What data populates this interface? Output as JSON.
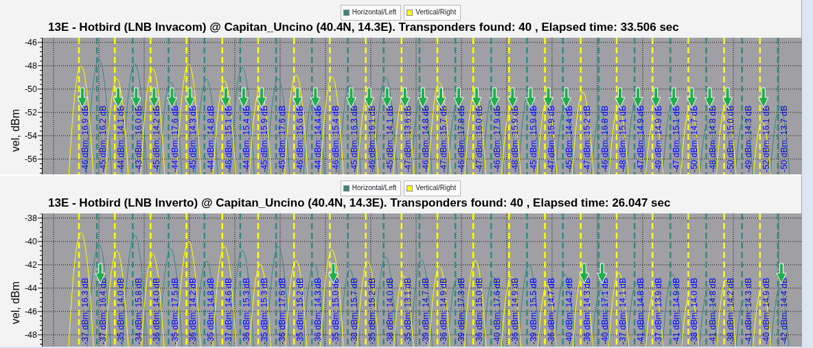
{
  "panels": [
    {
      "legend": [
        {
          "label": "Horizontal/Left",
          "color": "#2e8b80"
        },
        {
          "label": "Vertical/Right",
          "color": "#ffff00"
        }
      ],
      "title": "13E - Hotbird (LNB Invacom) @ Capitan_Uncino (40.4N, 14.3E). Transponders found: 40 , Elapsed time: 33.506 sec",
      "y_axis": {
        "label": "vel, dBm",
        "ticks": [
          "-46",
          "-48",
          "-50",
          "-52",
          "-54",
          "-56"
        ]
      },
      "transponders": [
        {
          "label": "-46 dBm; 16.9 dB",
          "kind": "vertical",
          "arrow": true
        },
        {
          "label": "-45 dBm; 16.2 dB",
          "kind": "horizontal",
          "arrow": false
        },
        {
          "label": "-44 dBm; 14.1 dB",
          "kind": "vertical",
          "arrow": true
        },
        {
          "label": "-43 dBm; 16.0 dB",
          "kind": "horizontal",
          "arrow": true
        },
        {
          "label": "-45 dBm; 14.2 dB",
          "kind": "vertical",
          "arrow": true
        },
        {
          "label": "-44 dBm; 17.6 dB",
          "kind": "horizontal",
          "arrow": true
        },
        {
          "label": "-45 dBm; 14.3 dB",
          "kind": "vertical",
          "arrow": true
        },
        {
          "label": "-44 dBm; 14.8 dB",
          "kind": "horizontal",
          "arrow": false
        },
        {
          "label": "-46 dBm; 15.1 dB",
          "kind": "vertical",
          "arrow": true
        },
        {
          "label": "-44 dBm; 15.4 dB",
          "kind": "horizontal",
          "arrow": true
        },
        {
          "label": "-45 dBm; 15.9 dB",
          "kind": "vertical",
          "arrow": true
        },
        {
          "label": "-45 dBm; 17.6 dB",
          "kind": "horizontal",
          "arrow": false
        },
        {
          "label": "-46 dBm; 15.6 dB",
          "kind": "vertical",
          "arrow": true
        },
        {
          "label": "-44 dBm; 14.4 dB",
          "kind": "horizontal",
          "arrow": true
        },
        {
          "label": "-46 dBm; 15.4 dB",
          "kind": "vertical",
          "arrow": false
        },
        {
          "label": "-45 dBm; 16.3 dB",
          "kind": "horizontal",
          "arrow": true
        },
        {
          "label": "-46 dBm; 16.1 dB",
          "kind": "vertical",
          "arrow": true
        },
        {
          "label": "-45 dBm; 14.1 dB",
          "kind": "horizontal",
          "arrow": true
        },
        {
          "label": "-47 dBm; 13.6 dB",
          "kind": "vertical",
          "arrow": true
        },
        {
          "label": "-46 dBm; 14.8 dB",
          "kind": "horizontal",
          "arrow": true
        },
        {
          "label": "-47 dBm; 15.7 dB",
          "kind": "vertical",
          "arrow": true
        },
        {
          "label": "-46 dBm; 17.8 dB",
          "kind": "horizontal",
          "arrow": true
        },
        {
          "label": "-47 dBm; 16.0 dB",
          "kind": "vertical",
          "arrow": true
        },
        {
          "label": "-46 dBm; 17.9 dB",
          "kind": "horizontal",
          "arrow": true
        },
        {
          "label": "-48 dBm; 15.9 dB",
          "kind": "vertical",
          "arrow": true
        },
        {
          "label": "-45 dBm; 15.9 dB",
          "kind": "horizontal",
          "arrow": true
        },
        {
          "label": "-47 dBm; 15.9 dB",
          "kind": "vertical",
          "arrow": true
        },
        {
          "label": "-45 dBm; 14.4 dB",
          "kind": "horizontal",
          "arrow": true
        },
        {
          "label": "-47 dBm; 15.2 dB",
          "kind": "vertical",
          "arrow": false
        },
        {
          "label": "-46 dBm; 16.8 dB",
          "kind": "horizontal",
          "arrow": false
        },
        {
          "label": "-48 dBm; 15.1 dB",
          "kind": "vertical",
          "arrow": true
        },
        {
          "label": "-47 dBm; 14.9 dB",
          "kind": "horizontal",
          "arrow": true
        },
        {
          "label": "-49 dBm; 14.9 dB",
          "kind": "vertical",
          "arrow": true
        },
        {
          "label": "-47 dBm; 15.1 dB",
          "kind": "horizontal",
          "arrow": true
        },
        {
          "label": "-50 dBm; 14.7 dB",
          "kind": "vertical",
          "arrow": true
        },
        {
          "label": "-48 dBm; 14.8 dB",
          "kind": "horizontal",
          "arrow": true
        },
        {
          "label": "-50 dBm; 15.0 dB",
          "kind": "vertical",
          "arrow": true
        },
        {
          "label": "-49 dBm; 14.3 dB",
          "kind": "horizontal",
          "arrow": false
        },
        {
          "label": "-52 dBm; 16.1 dB",
          "kind": "vertical",
          "arrow": true
        },
        {
          "label": "-50 dBm; 13.7 dB",
          "kind": "horizontal",
          "arrow": false
        }
      ]
    },
    {
      "legend": [
        {
          "label": "Horizontal/Left",
          "color": "#2e8b80"
        },
        {
          "label": "Vertical/Right",
          "color": "#ffff00"
        }
      ],
      "title": "13E - Hotbird (LNB Inverto) @ Capitan_Uncino (40.4N, 14.3E). Transponders found: 40 , Elapsed time: 26.047 sec",
      "y_axis": {
        "label": "vel, dBm",
        "ticks": [
          "-38",
          "-40",
          "-42",
          "-44",
          "-46",
          "-48"
        ]
      },
      "transponders": [
        {
          "label": "-37 dBm; 16.3 dB",
          "kind": "vertical",
          "arrow": false
        },
        {
          "label": "-37 dBm; 16.4 dB",
          "kind": "horizontal",
          "arrow": true
        },
        {
          "label": "-35 dBm; 14.0 dB",
          "kind": "vertical",
          "arrow": false
        },
        {
          "label": "-34 dBm; 15.8 dB",
          "kind": "horizontal",
          "arrow": false
        },
        {
          "label": "-36 dBm; 14.0 dB",
          "kind": "vertical",
          "arrow": false
        },
        {
          "label": "-35 dBm; 17.5 dB",
          "kind": "horizontal",
          "arrow": false
        },
        {
          "label": "-36 dBm; 14.2 dB",
          "kind": "vertical",
          "arrow": false
        },
        {
          "label": "-35 dBm; 14.8 dB",
          "kind": "horizontal",
          "arrow": false
        },
        {
          "label": "-37 dBm; 14.6 dB",
          "kind": "vertical",
          "arrow": false
        },
        {
          "label": "-36 dBm; 15.3 dB",
          "kind": "horizontal",
          "arrow": false
        },
        {
          "label": "-35 dBm; 15.3 dB",
          "kind": "vertical",
          "arrow": false
        },
        {
          "label": "-36 dBm; 17.6 dB",
          "kind": "horizontal",
          "arrow": false
        },
        {
          "label": "-35 dBm; 15.2 dB",
          "kind": "vertical",
          "arrow": false
        },
        {
          "label": "-36 dBm; 14.3 dB",
          "kind": "horizontal",
          "arrow": false
        },
        {
          "label": "-35 dBm; 15.0 dB",
          "kind": "vertical",
          "arrow": true
        },
        {
          "label": "-38 dBm; 15.7 dB",
          "kind": "horizontal",
          "arrow": false
        },
        {
          "label": "-35 dBm; 15.2 dB",
          "kind": "vertical",
          "arrow": false
        },
        {
          "label": "-38 dBm; 14.0 dB",
          "kind": "horizontal",
          "arrow": false
        },
        {
          "label": "-35 dBm; 13.1 dB",
          "kind": "vertical",
          "arrow": false
        },
        {
          "label": "-39 dBm; 14.7 dB",
          "kind": "horizontal",
          "arrow": false
        },
        {
          "label": "-36 dBm; 14.9 dB",
          "kind": "vertical",
          "arrow": false
        },
        {
          "label": "-39 dBm; 17.3 dB",
          "kind": "horizontal",
          "arrow": false
        },
        {
          "label": "-36 dBm; 15.0 dB",
          "kind": "vertical",
          "arrow": false
        },
        {
          "label": "-40 dBm; 17.6 dB",
          "kind": "horizontal",
          "arrow": false
        },
        {
          "label": "-36 dBm; 14.9 dB",
          "kind": "vertical",
          "arrow": false
        },
        {
          "label": "-39 dBm; 15.5 dB",
          "kind": "horizontal",
          "arrow": false
        },
        {
          "label": "-36 dBm; 14.7 dB",
          "kind": "vertical",
          "arrow": false
        },
        {
          "label": "-40 dBm; 14.2 dB",
          "kind": "horizontal",
          "arrow": false
        },
        {
          "label": "-36 dBm; 14.3 dB",
          "kind": "vertical",
          "arrow": true
        },
        {
          "label": "-40 dBm; 17.1 dB",
          "kind": "horizontal",
          "arrow": true
        },
        {
          "label": "-37 dBm; 14.1 dB",
          "kind": "vertical",
          "arrow": false
        },
        {
          "label": "-41 dBm; 14.8 dB",
          "kind": "horizontal",
          "arrow": false
        },
        {
          "label": "-37 dBm; 13.9 dB",
          "kind": "vertical",
          "arrow": false
        },
        {
          "label": "-41 dBm; 14.9 dB",
          "kind": "horizontal",
          "arrow": false
        },
        {
          "label": "-38 dBm; 14.0 dB",
          "kind": "vertical",
          "arrow": false
        },
        {
          "label": "-41 dBm; 14.8 dB",
          "kind": "horizontal",
          "arrow": false
        },
        {
          "label": "-38 dBm; 14.2 dB",
          "kind": "vertical",
          "arrow": false
        },
        {
          "label": "-41 dBm; 14.3 dB",
          "kind": "horizontal",
          "arrow": false
        },
        {
          "label": "-40 dBm; 14.9 dB",
          "kind": "vertical",
          "arrow": false
        },
        {
          "label": "-42 dBm; 14.4 dB",
          "kind": "horizontal",
          "arrow": true
        }
      ]
    }
  ]
}
